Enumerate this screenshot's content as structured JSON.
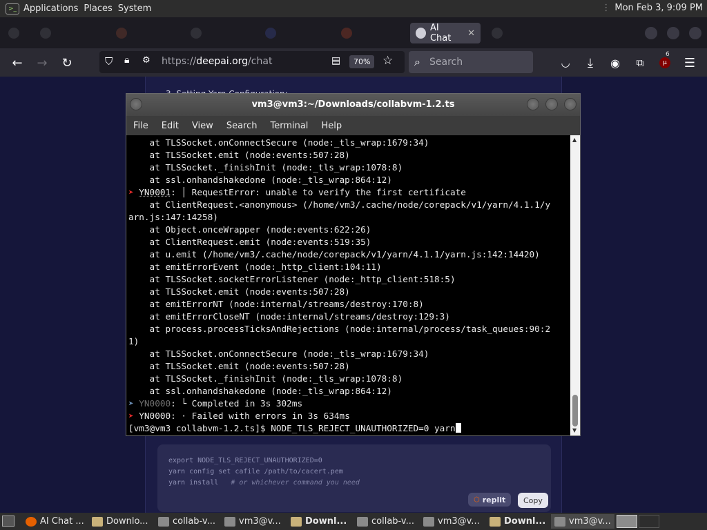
{
  "top_panel": {
    "menus": [
      "Applications",
      "Places",
      "System"
    ],
    "clock": "Mon Feb  3,  9:09 PM"
  },
  "browser": {
    "tabs": [
      {
        "label": "",
        "icon": "generic-tab-icon"
      },
      {
        "label": "",
        "icon": "github-icon"
      },
      {
        "label": "",
        "icon": "generic-tab-icon"
      },
      {
        "label": "",
        "icon": "github-icon"
      },
      {
        "label": "",
        "icon": "generic-tab-icon"
      },
      {
        "label": "",
        "icon": "brave-icon"
      },
      {
        "label": "AI Chat",
        "icon": "deepai-icon",
        "active": true
      },
      {
        "label": "",
        "icon": "generic-tab-icon"
      }
    ],
    "url_prefix": "https://",
    "url_host": "deepai.org",
    "url_path": "/chat",
    "zoom": "70%",
    "search_placeholder": "Search",
    "notification_count": "6"
  },
  "page": {
    "behind_heading": "3. Setting Yarn Configuration:",
    "code_lines": [
      "export NODE_TLS_REJECT_UNAUTHORIZED=0",
      "yarn config set cafile /path/to/cacert.pem",
      "yarn install"
    ],
    "code_comment": "# or whichever command you need",
    "replit_label": "replit",
    "copy_label": "Copy"
  },
  "terminal": {
    "title": "vm3@vm3:~/Downloads/collabvm-1.2.ts",
    "menu": [
      "File",
      "Edit",
      "View",
      "Search",
      "Terminal",
      "Help"
    ],
    "lines": [
      {
        "type": "plain",
        "text": "    at TLSSocket.onConnectSecure (node:_tls_wrap:1679:34)"
      },
      {
        "type": "plain",
        "text": "    at TLSSocket.emit (node:events:507:28)"
      },
      {
        "type": "plain",
        "text": "    at TLSSocket._finishInit (node:_tls_wrap:1078:8)"
      },
      {
        "type": "plain",
        "text": "    at ssl.onhandshakedone (node:_tls_wrap:864:12)"
      },
      {
        "type": "err",
        "code": "YN0001",
        "text": ": │ RequestError: unable to verify the first certificate"
      },
      {
        "type": "plain",
        "text": "    at ClientRequest.<anonymous> (/home/vm3/.cache/node/corepack/v1/yarn/4.1.1/y"
      },
      {
        "type": "plain",
        "text": "arn.js:147:14258)"
      },
      {
        "type": "plain",
        "text": "    at Object.onceWrapper (node:events:622:26)"
      },
      {
        "type": "plain",
        "text": "    at ClientRequest.emit (node:events:519:35)"
      },
      {
        "type": "plain",
        "text": "    at u.emit (/home/vm3/.cache/node/corepack/v1/yarn/4.1.1/yarn.js:142:14420)"
      },
      {
        "type": "plain",
        "text": "    at emitErrorEvent (node:_http_client:104:11)"
      },
      {
        "type": "plain",
        "text": "    at TLSSocket.socketErrorListener (node:_http_client:518:5)"
      },
      {
        "type": "plain",
        "text": "    at TLSSocket.emit (node:events:507:28)"
      },
      {
        "type": "plain",
        "text": "    at emitErrorNT (node:internal/streams/destroy:170:8)"
      },
      {
        "type": "plain",
        "text": "    at emitErrorCloseNT (node:internal/streams/destroy:129:3)"
      },
      {
        "type": "plain",
        "text": "    at process.processTicksAndRejections (node:internal/process/task_queues:90:2"
      },
      {
        "type": "plain",
        "text": "1)"
      },
      {
        "type": "plain",
        "text": "    at TLSSocket.onConnectSecure (node:_tls_wrap:1679:34)"
      },
      {
        "type": "plain",
        "text": "    at TLSSocket.emit (node:events:507:28)"
      },
      {
        "type": "plain",
        "text": "    at TLSSocket._finishInit (node:_tls_wrap:1078:8)"
      },
      {
        "type": "plain",
        "text": "    at ssl.onhandshakedone (node:_tls_wrap:864:12)"
      },
      {
        "type": "info",
        "code": "YN0000",
        "text": ": └ Completed in 3s 302ms"
      },
      {
        "type": "err",
        "code": "YN0000",
        "text": ": · Failed with errors in 3s 634ms"
      },
      {
        "type": "prompt",
        "text": "[vm3@vm3 collabvm-1.2.ts]$ NODE_TLS_REJECT_UNAUTHORIZED=0 yarn"
      }
    ]
  },
  "taskbar": {
    "items": [
      {
        "label": "AI Chat ...",
        "icon": "firefox-icon",
        "bold": false
      },
      {
        "label": "Downlo...",
        "icon": "folder-icon",
        "bold": false
      },
      {
        "label": "collab-v...",
        "icon": "editor-icon",
        "bold": false
      },
      {
        "label": "vm3@v...",
        "icon": "terminal-icon",
        "bold": false
      },
      {
        "label": "Downl...",
        "icon": "folder-icon",
        "bold": true
      },
      {
        "label": "collab-v...",
        "icon": "editor-icon",
        "bold": false
      },
      {
        "label": "vm3@v...",
        "icon": "terminal-icon",
        "bold": false
      },
      {
        "label": "Downl...",
        "icon": "folder-icon",
        "bold": true
      },
      {
        "label": "vm3@v...",
        "icon": "terminal-icon",
        "bold": false,
        "active": true
      }
    ]
  }
}
